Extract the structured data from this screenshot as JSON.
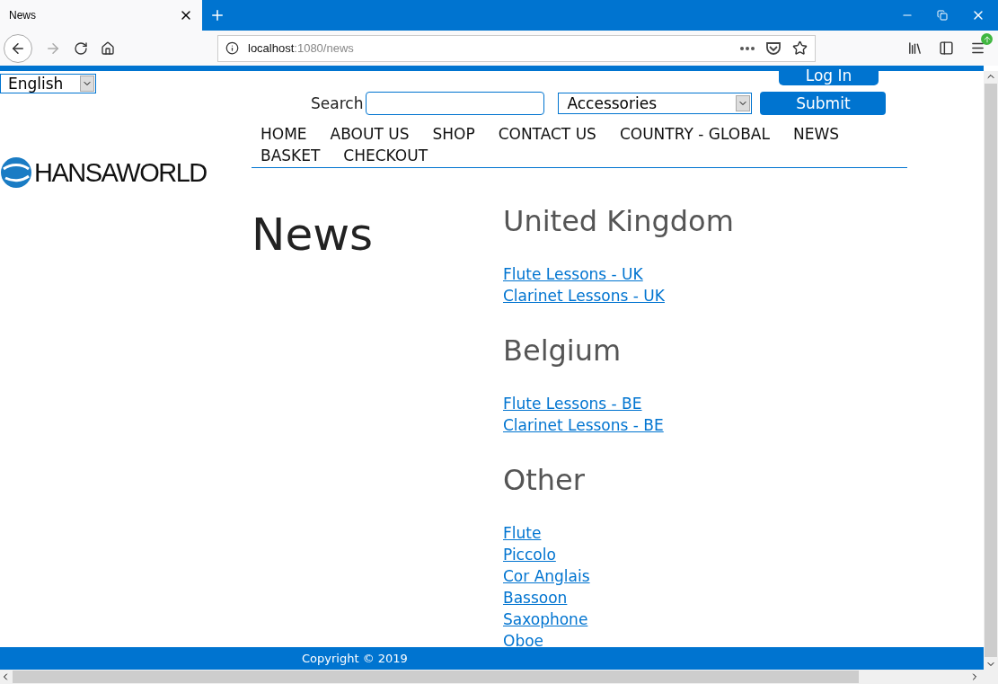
{
  "browser": {
    "tab_title": "News",
    "url_host": "localhost",
    "url_path": ":1080/news"
  },
  "header": {
    "language": "English",
    "login": "Log In",
    "search_label": "Search",
    "category": "Accessories",
    "submit": "Submit",
    "logo_text": "HANSAWORLD",
    "nav": [
      {
        "label": "HOME"
      },
      {
        "label": "ABOUT US"
      },
      {
        "label": "SHOP"
      },
      {
        "label": "CONTACT US"
      },
      {
        "label": "COUNTRY - GLOBAL"
      },
      {
        "label": "NEWS"
      },
      {
        "label": "BASKET"
      },
      {
        "label": "CHECKOUT"
      }
    ]
  },
  "page_title": "News",
  "sections": [
    {
      "title": "United Kingdom",
      "links": [
        "Flute Lessons - UK",
        "Clarinet Lessons - UK"
      ]
    },
    {
      "title": "Belgium",
      "links": [
        "Flute Lessons - BE",
        "Clarinet Lessons - BE"
      ]
    },
    {
      "title": "Other",
      "links": [
        "Flute",
        "Piccolo",
        "Cor Anglais",
        "Bassoon",
        "Saxophone",
        "Oboe"
      ]
    }
  ],
  "footer": "Copyright © 2019"
}
